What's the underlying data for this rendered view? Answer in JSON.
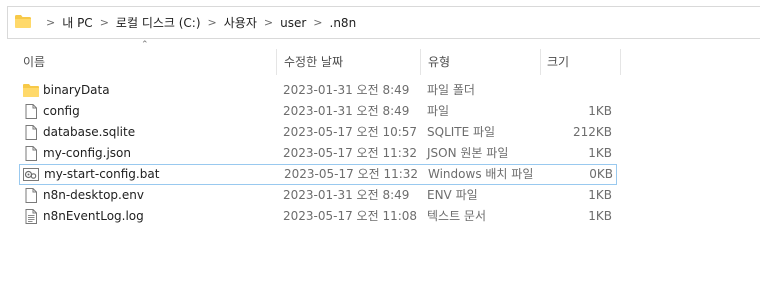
{
  "address_bar": {
    "path": [
      "내 PC",
      "로컬 디스크 (C:)",
      "사용자",
      "user",
      ".n8n"
    ],
    "separator": ">"
  },
  "columns": {
    "name": "이름",
    "date": "수정한 날짜",
    "type": "유형",
    "size": "크기"
  },
  "files": [
    {
      "name": "binaryData",
      "date": "2023-01-31 오전 8:49",
      "type": "파일 폴더",
      "size": "",
      "icon": "folder-icon"
    },
    {
      "name": "config",
      "date": "2023-01-31 오전 8:49",
      "type": "파일",
      "size": "1KB",
      "icon": "file-icon"
    },
    {
      "name": "database.sqlite",
      "date": "2023-05-17 오전 10:57",
      "type": "SQLITE 파일",
      "size": "212KB",
      "icon": "file-icon"
    },
    {
      "name": "my-config.json",
      "date": "2023-05-17 오전 11:32",
      "type": "JSON 원본 파일",
      "size": "1KB",
      "icon": "file-icon"
    },
    {
      "name": "my-start-config.bat",
      "date": "2023-05-17 오전 11:32",
      "type": "Windows 배치 파일",
      "size": "0KB",
      "icon": "batch-file-icon",
      "selected": true
    },
    {
      "name": "n8n-desktop.env",
      "date": "2023-01-31 오전 8:49",
      "type": "ENV 파일",
      "size": "1KB",
      "icon": "file-icon"
    },
    {
      "name": "n8nEventLog.log",
      "date": "2023-05-17 오전 11:08",
      "type": "텍스트 문서",
      "size": "1KB",
      "icon": "text-file-icon"
    }
  ],
  "colors": {
    "folder": "#f7c948",
    "selection_border": "#99c9ef"
  }
}
